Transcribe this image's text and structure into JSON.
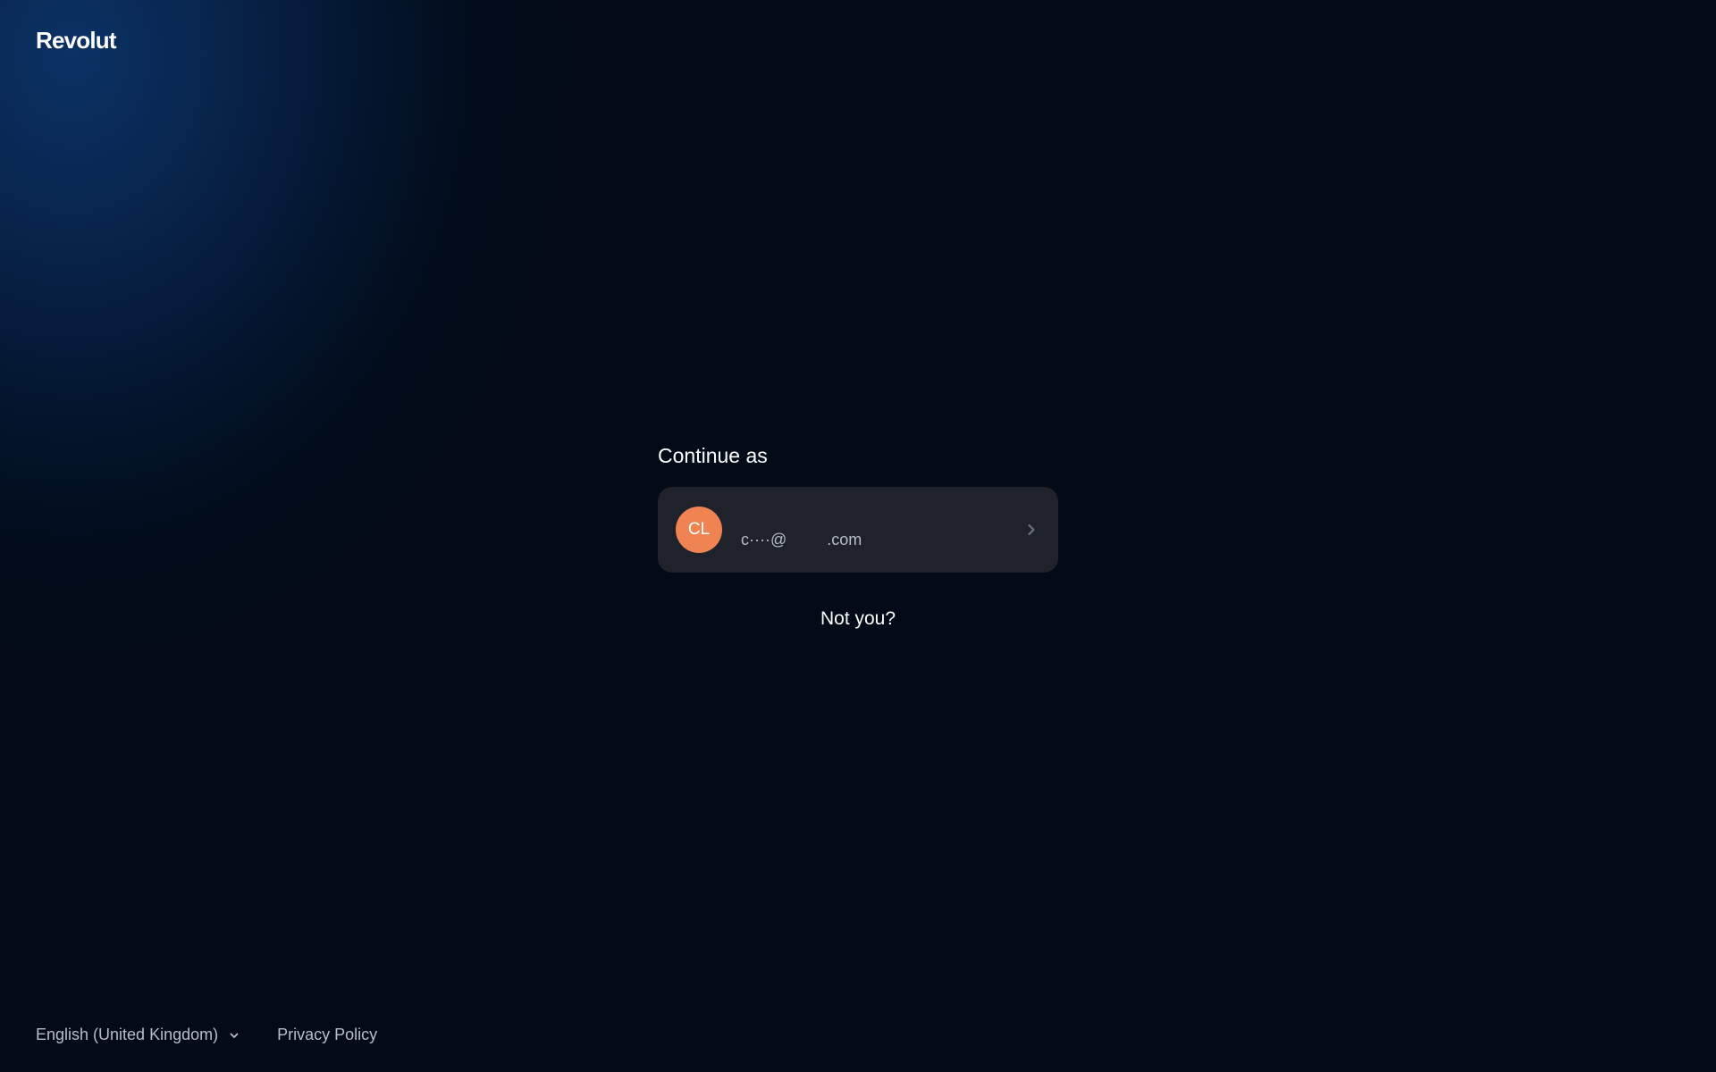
{
  "brand": {
    "logo_text": "Revolut"
  },
  "main": {
    "heading": "Continue as",
    "account": {
      "initials": "CL",
      "email": "c····@         .com"
    },
    "not_you_label": "Not you?"
  },
  "footer": {
    "language_label": "English (United Kingdom)",
    "privacy_label": "Privacy Policy"
  },
  "icons": {
    "account_arrow": "chevron-right-icon",
    "language_dropdown": "chevron-down-icon"
  },
  "colors": {
    "background": "#020b17",
    "glow": "#0c3469",
    "card": "#1f222b",
    "avatar": "#ef8352",
    "muted_text": "#b7bcc6"
  }
}
